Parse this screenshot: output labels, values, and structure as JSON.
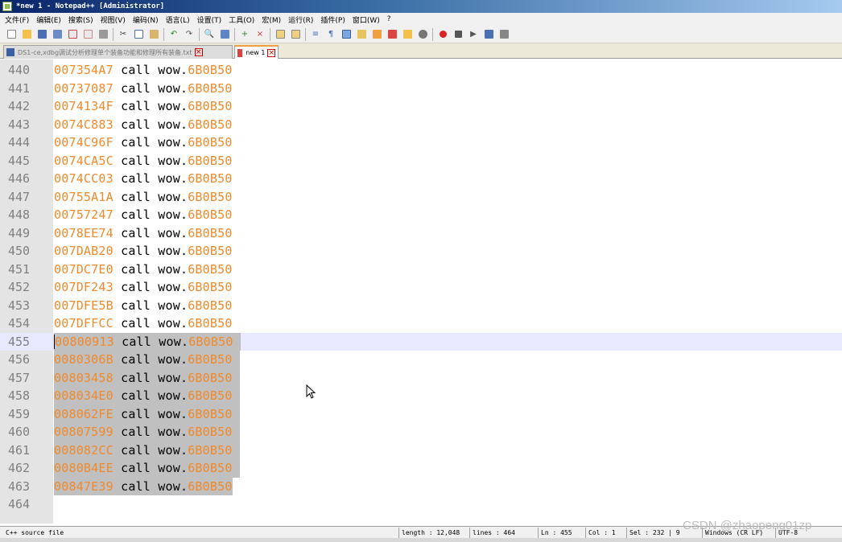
{
  "window": {
    "title": "*new 1 - Notepad++ [Administrator]"
  },
  "menu": [
    "文件(F)",
    "编辑(E)",
    "搜索(S)",
    "视图(V)",
    "编码(N)",
    "语言(L)",
    "设置(T)",
    "工具(O)",
    "宏(M)",
    "运行(R)",
    "插件(P)",
    "窗口(W)",
    "?"
  ],
  "tabs": [
    {
      "label": "DS1-ce,xdbg调试分析修理单个装备功能和修理所有装备.txt",
      "active": false
    },
    {
      "label": "new 1",
      "active": true
    }
  ],
  "editor": {
    "keyword": "call",
    "module": "wow.",
    "target": "6B0B50",
    "lines": [
      {
        "num": "440",
        "addr": "007354A7"
      },
      {
        "num": "441",
        "addr": "00737087"
      },
      {
        "num": "442",
        "addr": "0074134F"
      },
      {
        "num": "443",
        "addr": "0074C883"
      },
      {
        "num": "444",
        "addr": "0074C96F"
      },
      {
        "num": "445",
        "addr": "0074CA5C"
      },
      {
        "num": "446",
        "addr": "0074CC03"
      },
      {
        "num": "447",
        "addr": "00755A1A"
      },
      {
        "num": "448",
        "addr": "00757247"
      },
      {
        "num": "449",
        "addr": "0078EE74"
      },
      {
        "num": "450",
        "addr": "007DAB20"
      },
      {
        "num": "451",
        "addr": "007DC7E0"
      },
      {
        "num": "452",
        "addr": "007DF243"
      },
      {
        "num": "453",
        "addr": "007DFE5B"
      },
      {
        "num": "454",
        "addr": "007DFFCC"
      },
      {
        "num": "455",
        "addr": "00800913"
      },
      {
        "num": "456",
        "addr": "0080306B"
      },
      {
        "num": "457",
        "addr": "00803458"
      },
      {
        "num": "458",
        "addr": "008034E0"
      },
      {
        "num": "459",
        "addr": "008062FE"
      },
      {
        "num": "460",
        "addr": "00807599"
      },
      {
        "num": "461",
        "addr": "008082CC"
      },
      {
        "num": "462",
        "addr": "0080B4EE"
      },
      {
        "num": "463",
        "addr": "00847E39"
      },
      {
        "num": "464",
        "addr": ""
      }
    ],
    "current_line": "455",
    "selection_first_line": "455",
    "selection_last_line": "463"
  },
  "status": {
    "file_type": "C++ source file",
    "length": "length : 12,048",
    "lines": "lines : 464",
    "ln": "Ln : 455",
    "col": "Col : 1",
    "sel": "Sel : 232 | 9",
    "eol": "Windows (CR LF)",
    "encoding": "UTF-8"
  },
  "watermark": "CSDN @zhaopeng01zp",
  "colors": {
    "address": "#f08a2c",
    "selection": "#c0c0c0",
    "current_line": "#e8e8ff",
    "gutter": "#e4e4e4"
  }
}
